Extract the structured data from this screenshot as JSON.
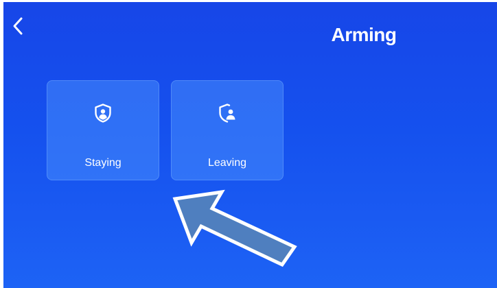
{
  "header": {
    "title": "Arming",
    "back_icon": "chevron-left-icon"
  },
  "modes": [
    {
      "label": "Staying",
      "icon": "shield-user-icon"
    },
    {
      "label": "Leaving",
      "icon": "shield-user-exit-icon"
    }
  ],
  "annotation": {
    "icon": "pointer-arrow-icon"
  },
  "colors": {
    "background_top": "#1746e8",
    "background_bottom": "#1d63f5",
    "tile": "#5096ff",
    "text": "#ffffff",
    "arrow_fill": "#4f7fbf",
    "arrow_stroke": "#ffffff"
  }
}
